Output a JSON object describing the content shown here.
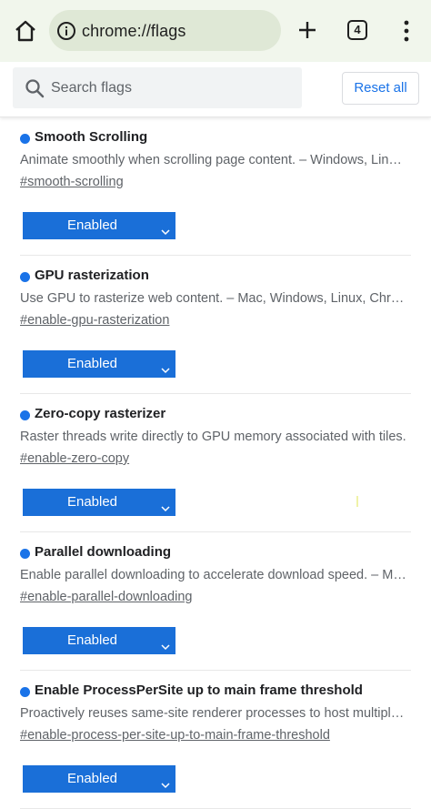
{
  "browser": {
    "url": "chrome://flags",
    "tab_count": "4",
    "icons": [
      "home-icon",
      "info-icon",
      "plus-icon",
      "tabs-icon",
      "more-vert-icon"
    ]
  },
  "search": {
    "placeholder": "Search flags",
    "reset_label": "Reset all"
  },
  "colors": {
    "accent": "#1a73e8",
    "toolbar_bg": "#f1f6ec",
    "omnibox_bg": "#dfe8d6"
  },
  "flags": [
    {
      "name": "Smooth Scrolling",
      "description": "Animate smoothly when scrolling page content. – Windows, Linux, ChromeOS, Android",
      "link": "#smooth-scrolling",
      "state": "Enabled"
    },
    {
      "name": "GPU rasterization",
      "description": "Use GPU to rasterize web content. – Mac, Windows, Linux, ChromeOS, Android",
      "link": "#enable-gpu-rasterization",
      "state": "Enabled"
    },
    {
      "name": "Zero-copy rasterizer",
      "description": "Raster threads write directly to GPU memory associated with tiles.",
      "link": "#enable-zero-copy",
      "state": "Enabled"
    },
    {
      "name": "Parallel downloading",
      "description": "Enable parallel downloading to accelerate download speed. – Mac, Windows, Linux",
      "link": "#enable-parallel-downloading",
      "state": "Enabled"
    },
    {
      "name": "Enable ProcessPerSite up to main frame threshold",
      "description": "Proactively reuses same-site renderer processes to host multiple main frames",
      "link": "#enable-process-per-site-up-to-main-frame-threshold",
      "state": "Enabled"
    }
  ]
}
